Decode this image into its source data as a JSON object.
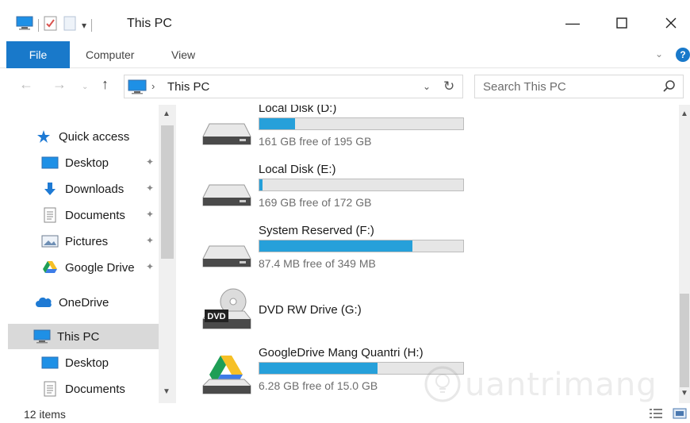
{
  "window": {
    "title": "This PC"
  },
  "ribbon": {
    "tabs": [
      "File",
      "Computer",
      "View"
    ]
  },
  "nav": {
    "address": "This PC",
    "search_placeholder": "Search This PC"
  },
  "sidebar": {
    "items": [
      {
        "label": "Quick access",
        "icon": "star-icon",
        "pinned": false
      },
      {
        "label": "Desktop",
        "icon": "desktop-icon",
        "pinned": true
      },
      {
        "label": "Downloads",
        "icon": "download-arrow-icon",
        "pinned": true
      },
      {
        "label": "Documents",
        "icon": "document-icon",
        "pinned": true
      },
      {
        "label": "Pictures",
        "icon": "pictures-icon",
        "pinned": true
      },
      {
        "label": "Google Drive",
        "icon": "google-drive-icon",
        "pinned": true
      },
      {
        "label": "OneDrive",
        "icon": "cloud-icon",
        "pinned": false
      },
      {
        "label": "This PC",
        "icon": "computer-icon",
        "pinned": false,
        "selected": true
      },
      {
        "label": "Desktop",
        "icon": "desktop-icon",
        "pinned": false
      },
      {
        "label": "Documents",
        "icon": "document-icon",
        "pinned": false
      }
    ]
  },
  "drives": [
    {
      "name": "Local Disk (D:)",
      "free": "161 GB free of 195 GB",
      "used_fraction": 0.175,
      "icon": "hard-disk-icon"
    },
    {
      "name": "Local Disk (E:)",
      "free": "169 GB free of 172 GB",
      "used_fraction": 0.017,
      "icon": "hard-disk-icon"
    },
    {
      "name": "System Reserved (F:)",
      "free": "87.4 MB free of 349 MB",
      "used_fraction": 0.75,
      "icon": "hard-disk-icon"
    },
    {
      "name": "DVD RW Drive (G:)",
      "free": "",
      "used_fraction": null,
      "icon": "dvd-drive-icon",
      "icon_label": "DVD"
    },
    {
      "name": "GoogleDrive Mang Quantri (H:)",
      "free": "6.28 GB free of 15.0 GB",
      "used_fraction": 0.58,
      "icon": "google-drive-disk-icon"
    }
  ],
  "status": {
    "items": "12 items"
  },
  "watermark": {
    "text": "uantrimang"
  },
  "colors": {
    "accent": "#1979ca",
    "bar_fill": "#26a0da",
    "selected_bg": "#d9d9d9"
  }
}
